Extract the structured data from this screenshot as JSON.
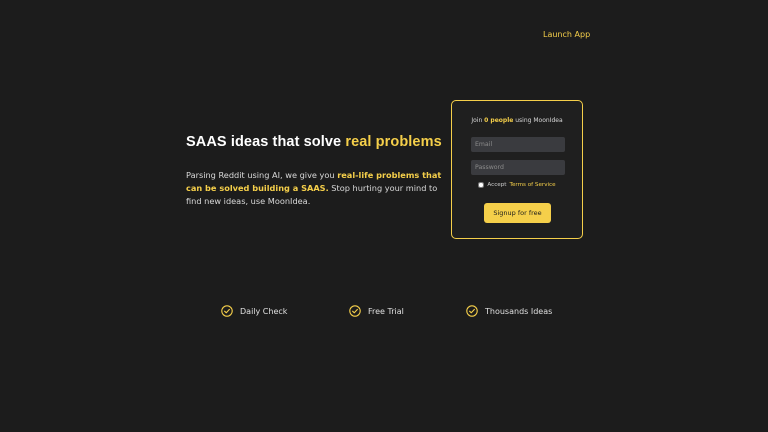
{
  "nav": {
    "launch_label": "Launch App"
  },
  "hero": {
    "title_main": "SAAS ideas that solve ",
    "title_highlight": "real problems",
    "desc_before": "Parsing Reddit using AI, we give you ",
    "desc_highlight": "real-life problems that can be solved building a SAAS.",
    "desc_after": " Stop hurting your mind to find new ideas, use MoonIdea."
  },
  "signup_card": {
    "join_prefix": "Join ",
    "join_count": "0 people",
    "join_suffix": " using MoonIdea",
    "email_placeholder": "Email",
    "password_placeholder": "Password",
    "terms_prefix": "Accept ",
    "terms_link": "Terms of Service",
    "button_label": "Signup for free"
  },
  "features": [
    {
      "icon": "check-circle-icon",
      "label": "Daily Check"
    },
    {
      "icon": "check-circle-icon",
      "label": "Free Trial"
    },
    {
      "icon": "check-circle-icon",
      "label": "Thousands Ideas"
    }
  ],
  "colors": {
    "accent": "#f5cf4a",
    "background": "#1c1c1c",
    "input_bg": "#3a3b3f"
  }
}
